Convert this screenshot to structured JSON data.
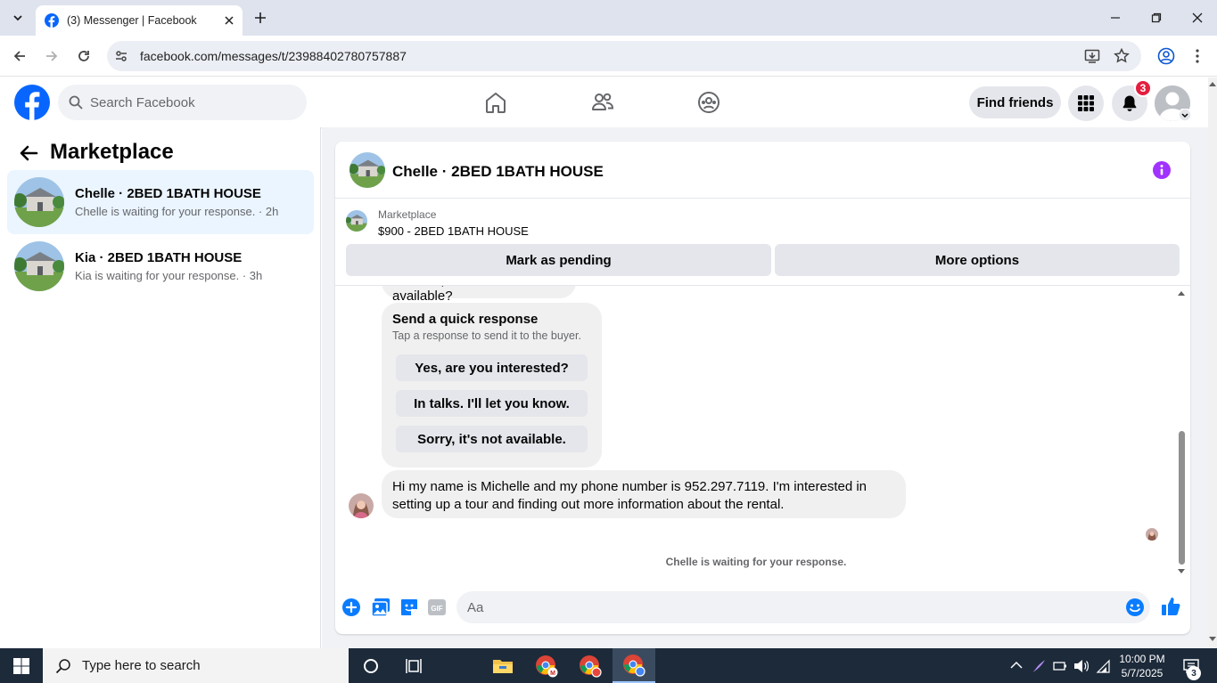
{
  "browser": {
    "tab_title": "(3) Messenger | Facebook",
    "url": "facebook.com/messages/t/23988402780757887"
  },
  "header": {
    "search_placeholder": "Search Facebook",
    "find_friends": "Find friends",
    "notification_count": "3"
  },
  "sidebar": {
    "title": "Marketplace",
    "conversations": [
      {
        "name": "Chelle · 2BED 1BATH HOUSE",
        "preview": "Chelle is waiting for your response. · 2h",
        "active": true
      },
      {
        "name": "Kia · 2BED 1BATH HOUSE",
        "preview": "Kia is waiting for your response. · 3h",
        "active": false
      }
    ]
  },
  "conversation": {
    "title": "Chelle · 2BED 1BATH HOUSE",
    "listing_label": "Marketplace",
    "listing_title": "$900 - 2BED 1BATH HOUSE",
    "mark_pending": "Mark as pending",
    "more_options": "More options",
    "previous_message": "Hi Naoh, is this still available?",
    "quick_response": {
      "title": "Send a quick response",
      "subtitle": "Tap a response to send it to the buyer.",
      "options": [
        "Yes, are you interested?",
        "In talks. I'll let you know.",
        "Sorry, it's not available."
      ]
    },
    "message": "Hi my name is Michelle and my phone number is 952.297.7119. I'm interested in setting up a tour and finding out more information about the rental.",
    "waiting_status": "Chelle is waiting for your response.",
    "composer_placeholder": "Aa"
  },
  "taskbar": {
    "search_placeholder": "Type here to search",
    "time": "10:00 PM",
    "date": "5/7/2025",
    "notification_count": "3"
  },
  "colors": {
    "fb_blue": "#0866ff",
    "messenger_blue": "#0a7cff",
    "info_purple": "#a033ff",
    "badge_red": "#e41e3f"
  }
}
